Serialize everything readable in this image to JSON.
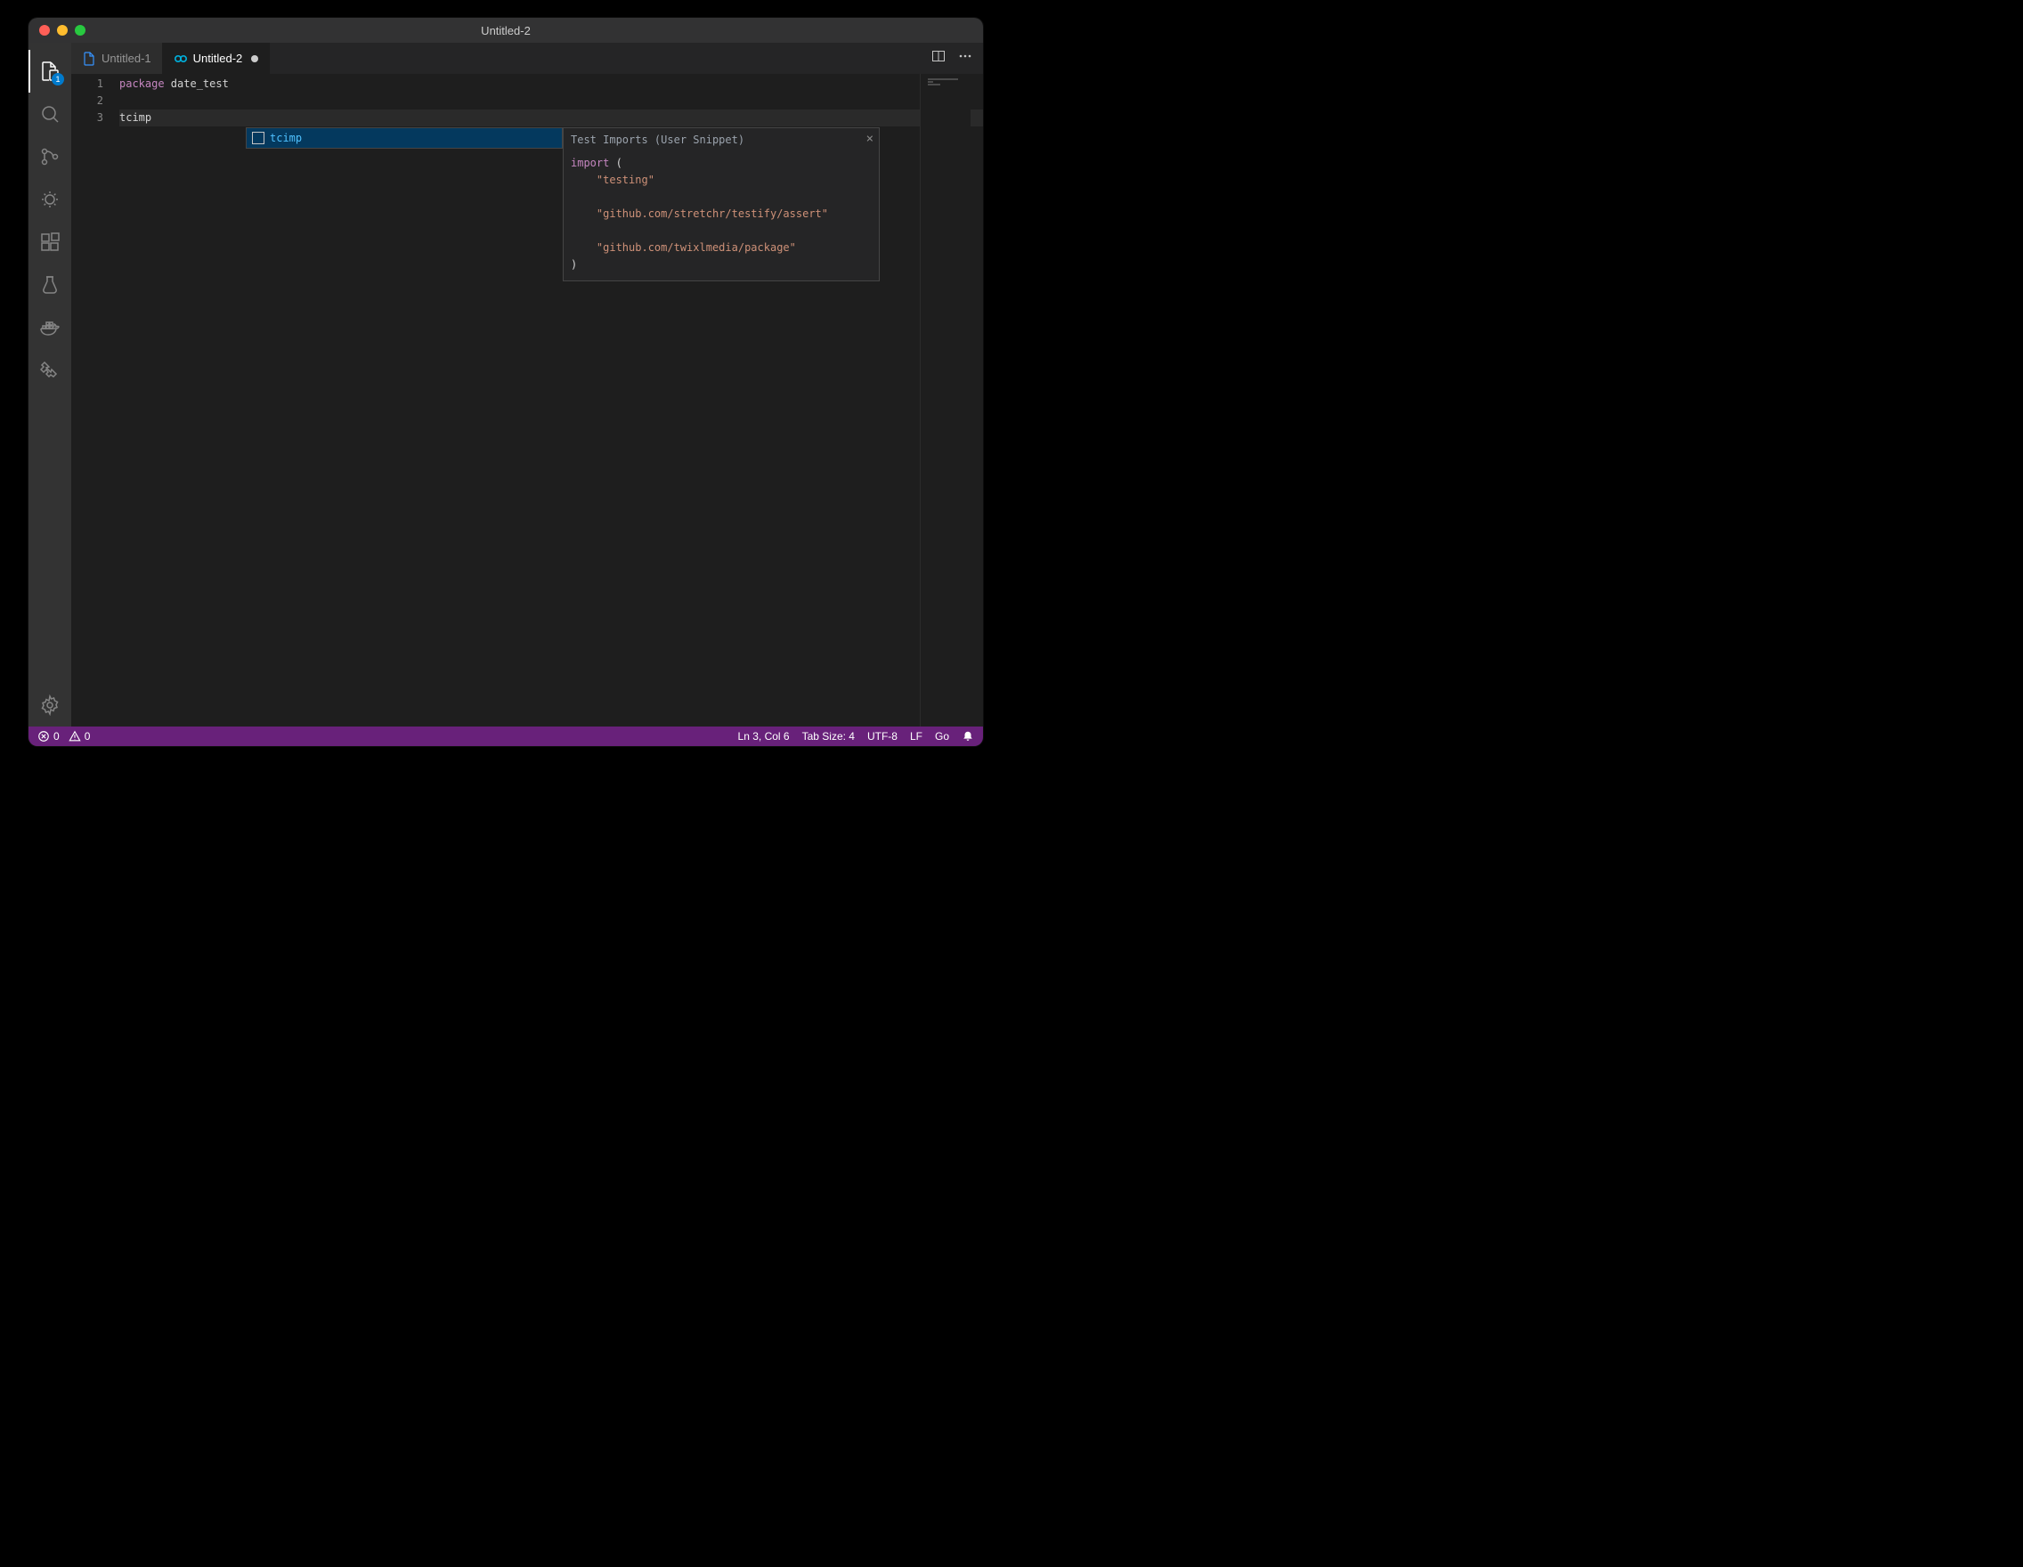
{
  "window": {
    "title": "Untitled-2"
  },
  "activity": {
    "explorer_badge": "1"
  },
  "tabs": {
    "items": [
      {
        "label": "Untitled-1",
        "dirty": false,
        "icon": "file"
      },
      {
        "label": "Untitled-2",
        "dirty": true,
        "icon": "go"
      }
    ]
  },
  "editor": {
    "gutter": [
      "1",
      "2",
      "3"
    ],
    "line1_keyword": "package",
    "line1_ident": " date_test",
    "line2": "",
    "line3": "tcimp"
  },
  "suggest": {
    "item": "tcimp"
  },
  "details": {
    "title": "Test Imports (User Snippet)",
    "line1_kw": "import",
    "line1_rest": " (",
    "line2_pad": "    ",
    "line2_str": "\"testing\"",
    "line4_pad": "    ",
    "line4_str": "\"github.com/stretchr/testify/assert\"",
    "line6_pad": "    ",
    "line6_str": "\"github.com/twixlmedia/package\"",
    "line7": ")"
  },
  "status": {
    "errors": "0",
    "warnings": "0",
    "cursor": "Ln 3, Col 6",
    "tabsize": "Tab Size: 4",
    "encoding": "UTF-8",
    "eol": "LF",
    "language": "Go"
  }
}
